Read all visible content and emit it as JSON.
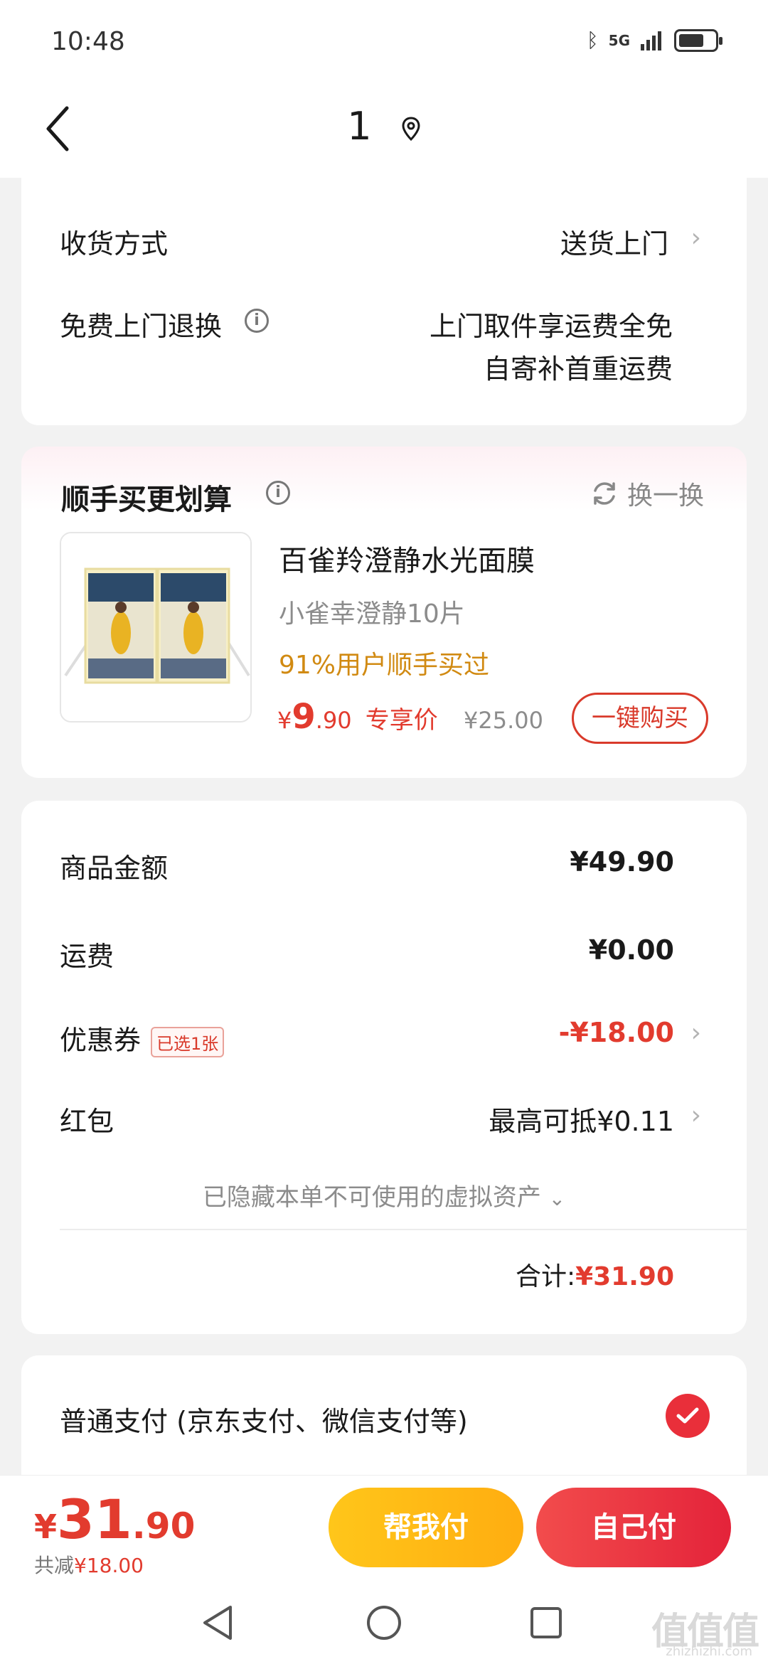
{
  "status_bar": {
    "time": "10:48",
    "network": "5G",
    "icons": [
      "bluetooth-icon",
      "signal-icon",
      "battery-icon"
    ]
  },
  "header": {
    "title": "1",
    "location_icon": "location-pin-icon"
  },
  "delivery": {
    "method_label": "收货方式",
    "method_value": "送货上门",
    "return_label": "免费上门退换",
    "return_line1": "上门取件享运费全免",
    "return_line2": "自寄补首重运费"
  },
  "addon": {
    "title": "顺手买更划算",
    "swap_label": "换一换",
    "product": {
      "name": "百雀羚澄静水光面膜",
      "spec": "小雀幸澄静10片",
      "hot": "91%用户顺手买过",
      "price_symbol": "¥",
      "price_int": "9",
      "price_dec": ".90",
      "price_tag": "专享价",
      "old_price": "¥25.00",
      "buy_label": "一键购买"
    }
  },
  "summary": {
    "goods_label": "商品金额",
    "goods_value": "¥49.90",
    "freight_label": "运费",
    "freight_value": "¥0.00",
    "coupon_label": "优惠券",
    "coupon_tag": "已选1张",
    "coupon_value": "-¥18.00",
    "redpacket_label": "红包",
    "redpacket_value": "最高可抵¥0.11",
    "hidden_note": "已隐藏本单不可使用的虚拟资产",
    "total_label": "合计:",
    "total_value": "¥31.90"
  },
  "payment": {
    "option_label": "普通支付 (京东支付、微信支付等)",
    "selected": true
  },
  "bottom": {
    "symbol": "¥",
    "total_int": "31",
    "total_dec": ".90",
    "save_label": "共减",
    "save_value": "¥18.00",
    "help_pay_label": "帮我付",
    "self_pay_label": "自己付"
  },
  "watermark": {
    "text": "值值值",
    "sub": "zhizhizhi.com"
  },
  "colors": {
    "accent_red": "#e23b2e",
    "yellow_button": "#ffb814",
    "red_button": "#e92f3a",
    "hot_orange": "#d18a12"
  }
}
